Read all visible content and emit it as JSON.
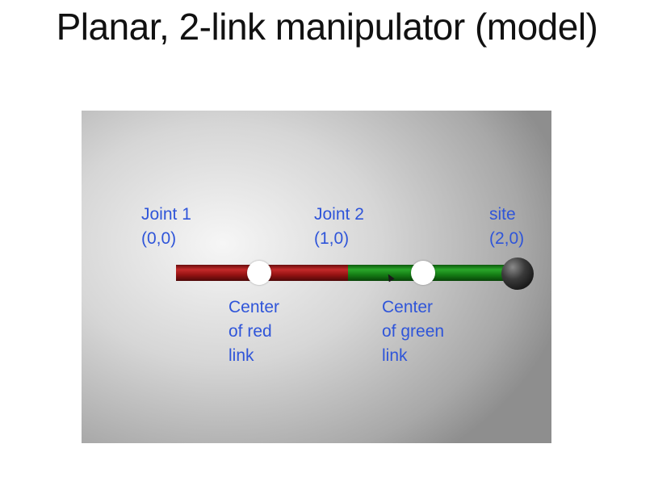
{
  "slide": {
    "title": "Planar, 2-link manipulator (model)"
  },
  "figure": {
    "joint1": {
      "name": "Joint 1",
      "coord": "(0,0)"
    },
    "joint2": {
      "name": "Joint 2",
      "coord": "(1,0)"
    },
    "site": {
      "name": "site",
      "coord": "(2,0)"
    },
    "red_center": {
      "line1": "Center",
      "line2": "of red",
      "line3": "link"
    },
    "green_center": {
      "line1": "Center",
      "line2": "of green",
      "line3": "link"
    },
    "colors": {
      "label": "#2f55d9",
      "red_link": "#b02020",
      "green_link": "#1f9a1f",
      "site_ball": "#1a1a1a",
      "center_marker": "#ffffff"
    },
    "icons": {
      "cursor": "mouse-pointer-icon"
    }
  }
}
